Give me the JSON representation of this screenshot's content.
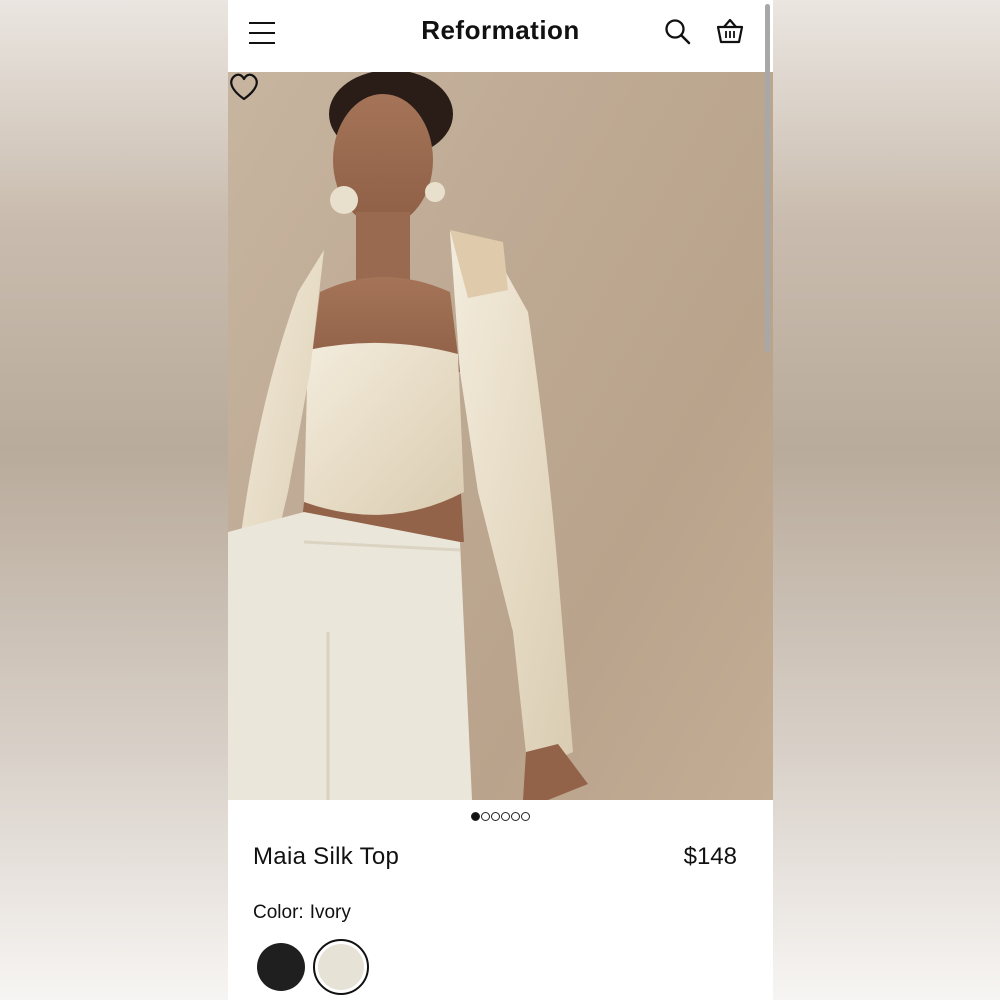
{
  "header": {
    "brand": "Reformation",
    "icons": [
      "menu-icon",
      "search-icon",
      "cart-icon"
    ]
  },
  "hero": {
    "favorite_icon": "heart-icon",
    "carousel": {
      "count": 6,
      "active_index": 0
    }
  },
  "product": {
    "title": "Maia Silk Top",
    "price": "$148",
    "color_label": "Color:",
    "color_value": "Ivory",
    "swatches": [
      {
        "name": "Black",
        "hex": "#1f1f1f",
        "selected": false
      },
      {
        "name": "Ivory",
        "hex": "#e6e2d6",
        "selected": true
      }
    ]
  },
  "colors": {
    "background_top": "#ebe6e1",
    "hero_backdrop": "#bda892",
    "text": "#111111"
  }
}
